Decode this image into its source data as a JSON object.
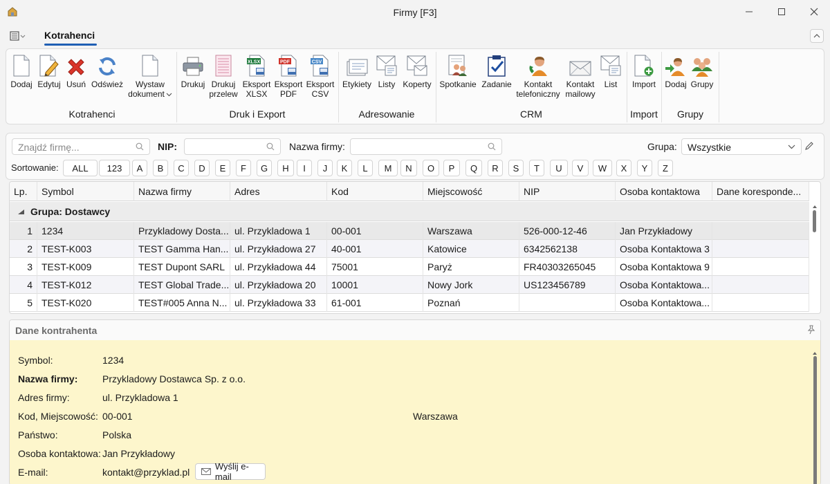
{
  "window": {
    "title": "Firmy [F3]"
  },
  "tabs": {
    "active": "Kotrahenci"
  },
  "ribbon": {
    "buttons": {
      "dodaj": "Dodaj",
      "edytuj": "Edytuj",
      "usun": "Usuń",
      "odswiez": "Odśwież",
      "wystaw_1": "Wystaw",
      "wystaw_2": "dokument",
      "drukuj": "Drukuj",
      "drukuj_przelew_1": "Drukuj",
      "drukuj_przelew_2": "przelew",
      "eksport_xlsx_1": "Eksport",
      "eksport_xlsx_2": "XLSX",
      "eksport_pdf_1": "Eksport",
      "eksport_pdf_2": "PDF",
      "eksport_csv_1": "Eksport",
      "eksport_csv_2": "CSV",
      "etykiety": "Etykiety",
      "listy": "Listy",
      "koperty": "Koperty",
      "spotkanie": "Spotkanie",
      "zadanie": "Zadanie",
      "kontakt_tel_1": "Kontakt",
      "kontakt_tel_2": "telefoniczny",
      "kontakt_mail_1": "Kontakt",
      "kontakt_mail_2": "mailowy",
      "list": "List",
      "import": "Import",
      "grupy_dodaj": "Dodaj",
      "grupy": "Grupy"
    },
    "groups": {
      "kotrahenci": "Kotrahenci",
      "druk": "Druk i Export",
      "adresowanie": "Adresowanie",
      "crm": "CRM",
      "import": "Import",
      "grupy": "Grupy"
    },
    "icon_text": {
      "xlsx": "XLSX",
      "pdf": "PDF",
      "csv": "CSV"
    }
  },
  "search": {
    "find_placeholder": "Znajdź firmę...",
    "nip_label": "NIP:",
    "nip_value": "",
    "name_label": "Nazwa firmy:",
    "name_value": "",
    "group_label": "Grupa:",
    "group_value": "Wszystkie",
    "sort_label": "Sortowanie:",
    "sort_options": [
      "ALL",
      "123",
      "A",
      "B",
      "C",
      "D",
      "E",
      "F",
      "G",
      "H",
      "I",
      "J",
      "K",
      "L",
      "M",
      "N",
      "O",
      "P",
      "Q",
      "R",
      "S",
      "T",
      "U",
      "V",
      "W",
      "X",
      "Y",
      "Z"
    ]
  },
  "grid": {
    "columns": [
      "Lp.",
      "Symbol",
      "Nazwa firmy",
      "Adres",
      "Kod",
      "Miejscowość",
      "NIP",
      "Osoba kontaktowa",
      "Dane koresponde..."
    ],
    "group_title": "Grupa: Dostawcy",
    "rows": [
      [
        "1",
        "1234",
        "Przykladowy Dosta...",
        "ul. Przykladowa 1",
        "00-001",
        "Warszawa",
        "526-000-12-46",
        "Jan Przykładowy",
        ""
      ],
      [
        "2",
        "TEST-K003",
        "TEST Gamma Han...",
        "ul. Przykładowa 27",
        "40-001",
        "Katowice",
        "6342562138",
        "Osoba Kontaktowa 3",
        ""
      ],
      [
        "3",
        "TEST-K009",
        "TEST Dupont SARL",
        "ul. Przykładowa 44",
        "75001",
        "Paryż",
        "FR40303265045",
        "Osoba Kontaktowa 9",
        ""
      ],
      [
        "4",
        "TEST-K012",
        "TEST Global Trade...",
        "ul. Przykładowa 20",
        "10001",
        "Nowy Jork",
        "US123456789",
        "Osoba Kontaktowa...",
        ""
      ],
      [
        "5",
        "TEST-K020",
        "TEST#005 Anna N...",
        "ul. Przykładowa 33",
        "61-001",
        "Poznań",
        "",
        "Osoba Kontaktowa...",
        ""
      ]
    ]
  },
  "details": {
    "title": "Dane kontrahenta",
    "symbol_label": "Symbol:",
    "symbol": "1234",
    "name_label": "Nazwa firmy:",
    "name": "Przykladowy Dostawca Sp. z o.o.",
    "address_label": "Adres firmy:",
    "address": "ul. Przykladowa 1",
    "city_label": "Kod, Miejscowość:",
    "postal": "00-001",
    "city": "Warszawa",
    "country_label": "Państwo:",
    "country": "Polska",
    "contact_label": "Osoba kontaktowa:",
    "contact": "Jan Przykładowy",
    "email_label": "E-mail:",
    "email": "kontakt@przyklad.pl",
    "send_email": "Wyślij e-mail"
  }
}
